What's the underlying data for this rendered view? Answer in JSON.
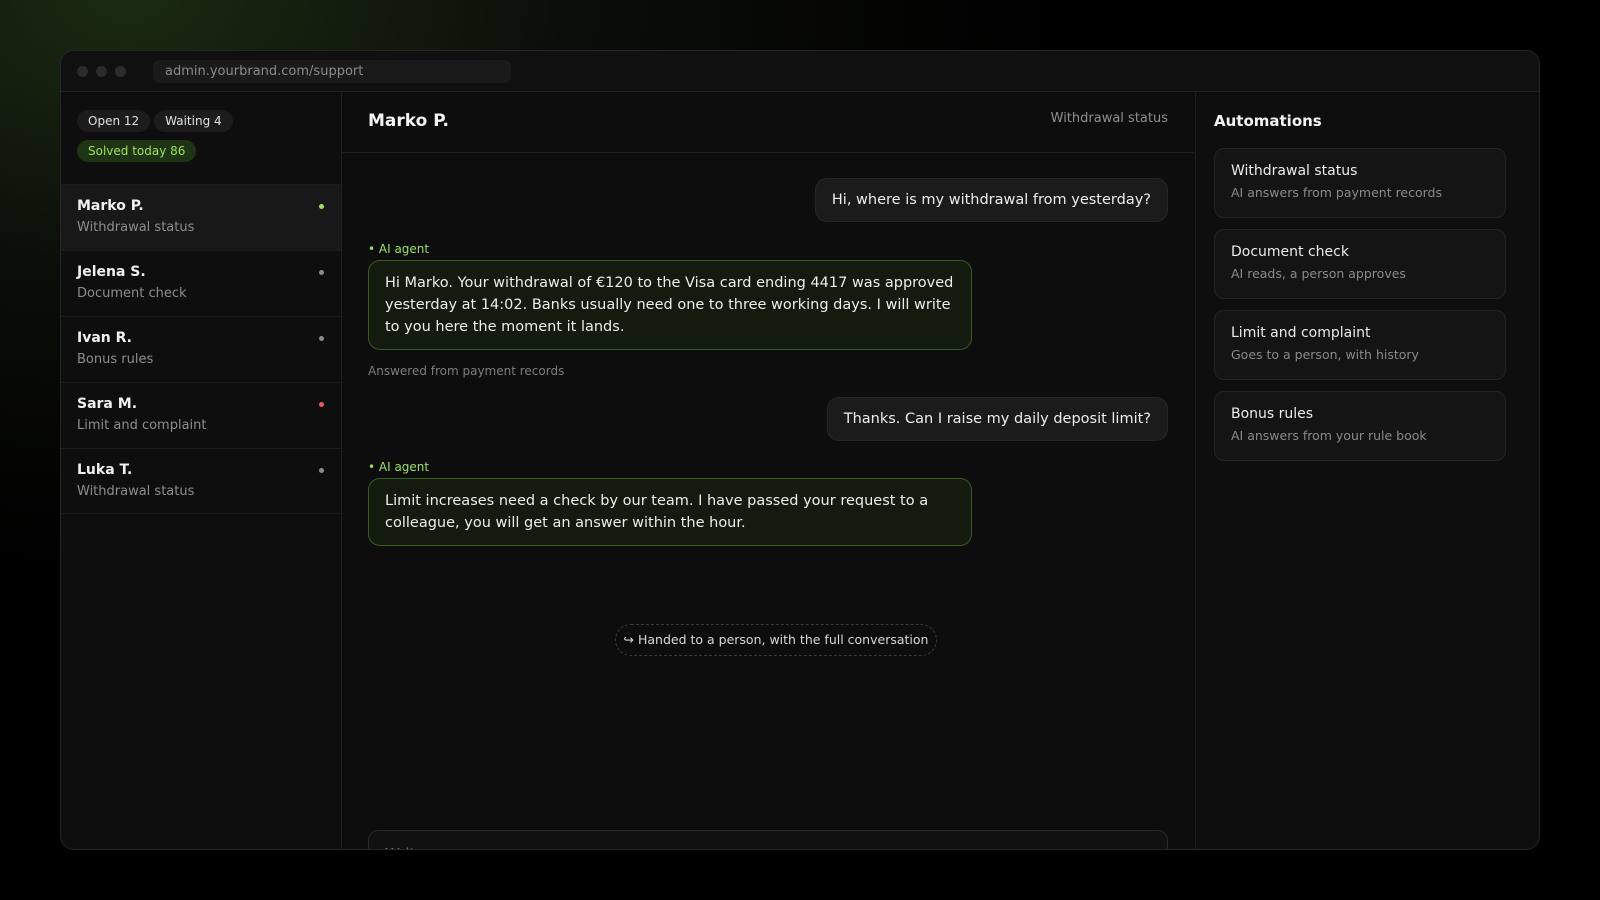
{
  "browser": {
    "url": "admin.yourbrand.com/support"
  },
  "sidebar": {
    "chips": [
      {
        "label": "Open 12"
      },
      {
        "label": "Waiting 4"
      },
      {
        "label": "Solved today 86"
      }
    ],
    "conversations": [
      {
        "name": "Marko P.",
        "topic": "Withdrawal status",
        "status_color": "#9be15d",
        "active": true
      },
      {
        "name": "Jelena S.",
        "topic": "Document check",
        "status_color": "#8a8a8a"
      },
      {
        "name": "Ivan R.",
        "topic": "Bonus rules",
        "status_color": "#8a8a8a"
      },
      {
        "name": "Sara M.",
        "topic": "Limit and complaint",
        "status_color": "#e25b5b"
      },
      {
        "name": "Luka T.",
        "topic": "Withdrawal status",
        "status_color": "#8a8a8a"
      }
    ]
  },
  "chat": {
    "title": "Marko P.",
    "topic": "Withdrawal status",
    "messages": [
      {
        "role": "user",
        "text": "Hi, where is my withdrawal from yesterday?"
      },
      {
        "role": "agent",
        "label": "• AI agent",
        "text": "Hi Marko. Your withdrawal of €120 to the Visa card ending 4417 was approved yesterday at 14:02. Banks usually need one to three working days. I will write to you here the moment it lands.",
        "meta": "Answered from payment records"
      },
      {
        "role": "user",
        "text": "Thanks. Can I raise my daily deposit limit?"
      },
      {
        "role": "agent",
        "label": "• AI agent",
        "text": "Limit increases need a check by our team. I have passed your request to a colleague, you will get an answer within the hour."
      }
    ],
    "handoff": "↪ Handed to a person, with the full conversation",
    "composer_placeholder": "Write a message"
  },
  "automations": {
    "title": "Automations",
    "items": [
      {
        "title": "Withdrawal status",
        "desc": "AI answers from payment records"
      },
      {
        "title": "Document check",
        "desc": "AI reads, a person approves"
      },
      {
        "title": "Limit and complaint",
        "desc": "Goes to a person, with history"
      },
      {
        "title": "Bonus rules",
        "desc": "AI answers from your rule book"
      }
    ]
  },
  "colors": {
    "accent": "#9be15d",
    "alert": "#e25b5b"
  }
}
